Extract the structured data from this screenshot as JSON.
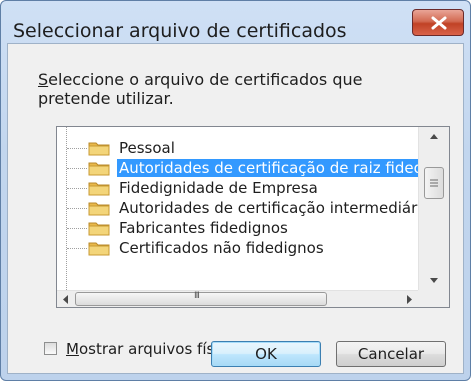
{
  "window": {
    "title": "Seleccionar arquivo de certificados",
    "close_icon": "close-icon"
  },
  "prompt": {
    "accesskey": "S",
    "text_rest": "eleccione o arquivo de certificados que pretende utilizar."
  },
  "tree": {
    "items": [
      {
        "label": "Pessoal",
        "selected": false
      },
      {
        "label": "Autoridades de certificação de raiz fidedi",
        "selected": true
      },
      {
        "label": "Fidedignidade de Empresa",
        "selected": false
      },
      {
        "label": "Autoridades de certificação intermediária",
        "selected": false
      },
      {
        "label": "Fabricantes fidedignos",
        "selected": false
      },
      {
        "label": "Certificados não fidedignos",
        "selected": false
      }
    ],
    "hscroll_grip": "III",
    "item_icon": "folder-icon"
  },
  "checkbox": {
    "accesskey": "M",
    "label_rest": "ostrar arquivos físicos",
    "checked": false
  },
  "buttons": {
    "ok": "OK",
    "cancel": "Cancelar"
  },
  "colors": {
    "selection": "#3399ff",
    "close_button": "#c04226",
    "folder": "#f3d57a"
  }
}
